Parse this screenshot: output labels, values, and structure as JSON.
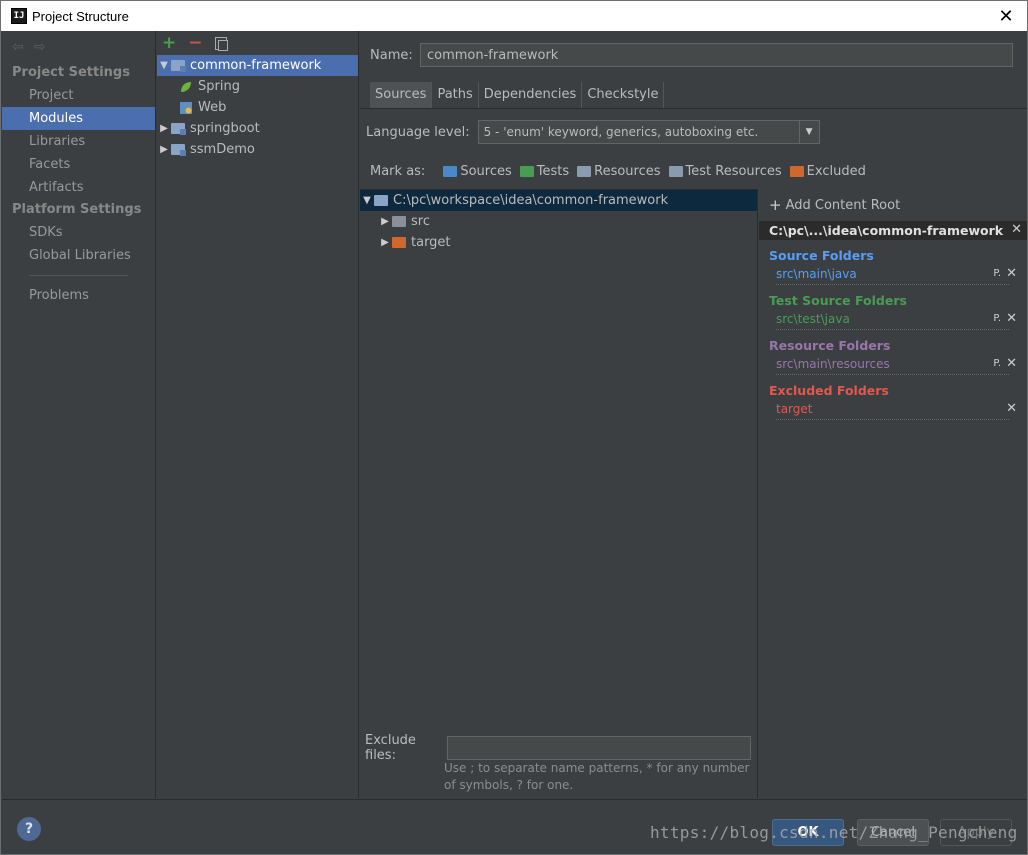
{
  "window": {
    "title": "Project Structure",
    "app_icon_text": "IJ"
  },
  "nav": {
    "project_settings_heading": "Project Settings",
    "project_settings": [
      "Project",
      "Modules",
      "Libraries",
      "Facets",
      "Artifacts"
    ],
    "platform_settings_heading": "Platform Settings",
    "platform_settings": [
      "SDKs",
      "Global Libraries"
    ],
    "problems": "Problems",
    "active": "Modules"
  },
  "modules": {
    "toolbar": {
      "add": "+",
      "remove": "−"
    },
    "tree": [
      {
        "label": "common-framework",
        "expanded": true,
        "selected": true
      },
      {
        "label": "Spring",
        "child": true,
        "kind": "spring"
      },
      {
        "label": "Web",
        "child": true,
        "kind": "web"
      },
      {
        "label": "springboot",
        "expanded": false
      },
      {
        "label": "ssmDemo",
        "expanded": false
      }
    ]
  },
  "content": {
    "name_label": "Name:",
    "name_value": "common-framework",
    "tabs": [
      "Sources",
      "Paths",
      "Dependencies",
      "Checkstyle"
    ],
    "active_tab": "Sources",
    "language_level_label": "Language level:",
    "language_level_value": "5 - 'enum' keyword, generics, autoboxing etc.",
    "mark_as_label": "Mark as:",
    "mark_as": [
      {
        "label": "Sources",
        "color": "#4a88c7"
      },
      {
        "label": "Tests",
        "color": "#499c54"
      },
      {
        "label": "Resources",
        "color": "#8a9bb0"
      },
      {
        "label": "Test Resources",
        "color": "#8a9bb0"
      },
      {
        "label": "Excluded",
        "color": "#d0672b"
      }
    ],
    "dir_tree": [
      {
        "label": "C:\\pc\\workspace\\idea\\common-framework",
        "level": 0,
        "expanded": true,
        "color": "#8aa4c8"
      },
      {
        "label": "src",
        "level": 1,
        "expanded": false,
        "color": "#8a9099"
      },
      {
        "label": "target",
        "level": 1,
        "expanded": false,
        "color": "#d0672b"
      }
    ],
    "exclude_label": "Exclude files:",
    "exclude_value": "",
    "exclude_hint": "Use ; to separate name patterns, * for any number of symbols, ? for one."
  },
  "roots": {
    "add_label": "Add Content Root",
    "root_path": "C:\\pc\\...\\idea\\common-framework",
    "groups": [
      {
        "title": "Source Folders",
        "color": "#589df6",
        "path": "src\\main\\java",
        "path_color": "#589df6",
        "has_p": true
      },
      {
        "title": "Test Source Folders",
        "color": "#499c54",
        "path": "src\\test\\java",
        "path_color": "#499c54",
        "has_p": true
      },
      {
        "title": "Resource Folders",
        "color": "#9876aa",
        "path": "src\\main\\resources",
        "path_color": "#9876aa",
        "has_p": true
      },
      {
        "title": "Excluded Folders",
        "color": "#e0584f",
        "path": "target",
        "path_color": "#e0584f",
        "has_p": false
      }
    ],
    "p_label": "P.",
    "x_label": "✕"
  },
  "buttons": {
    "help": "?",
    "ok": "OK",
    "cancel": "Cancel",
    "apply": "Apply"
  },
  "watermark": "https://blog.csdn.net/Zhang_Pengcheng"
}
